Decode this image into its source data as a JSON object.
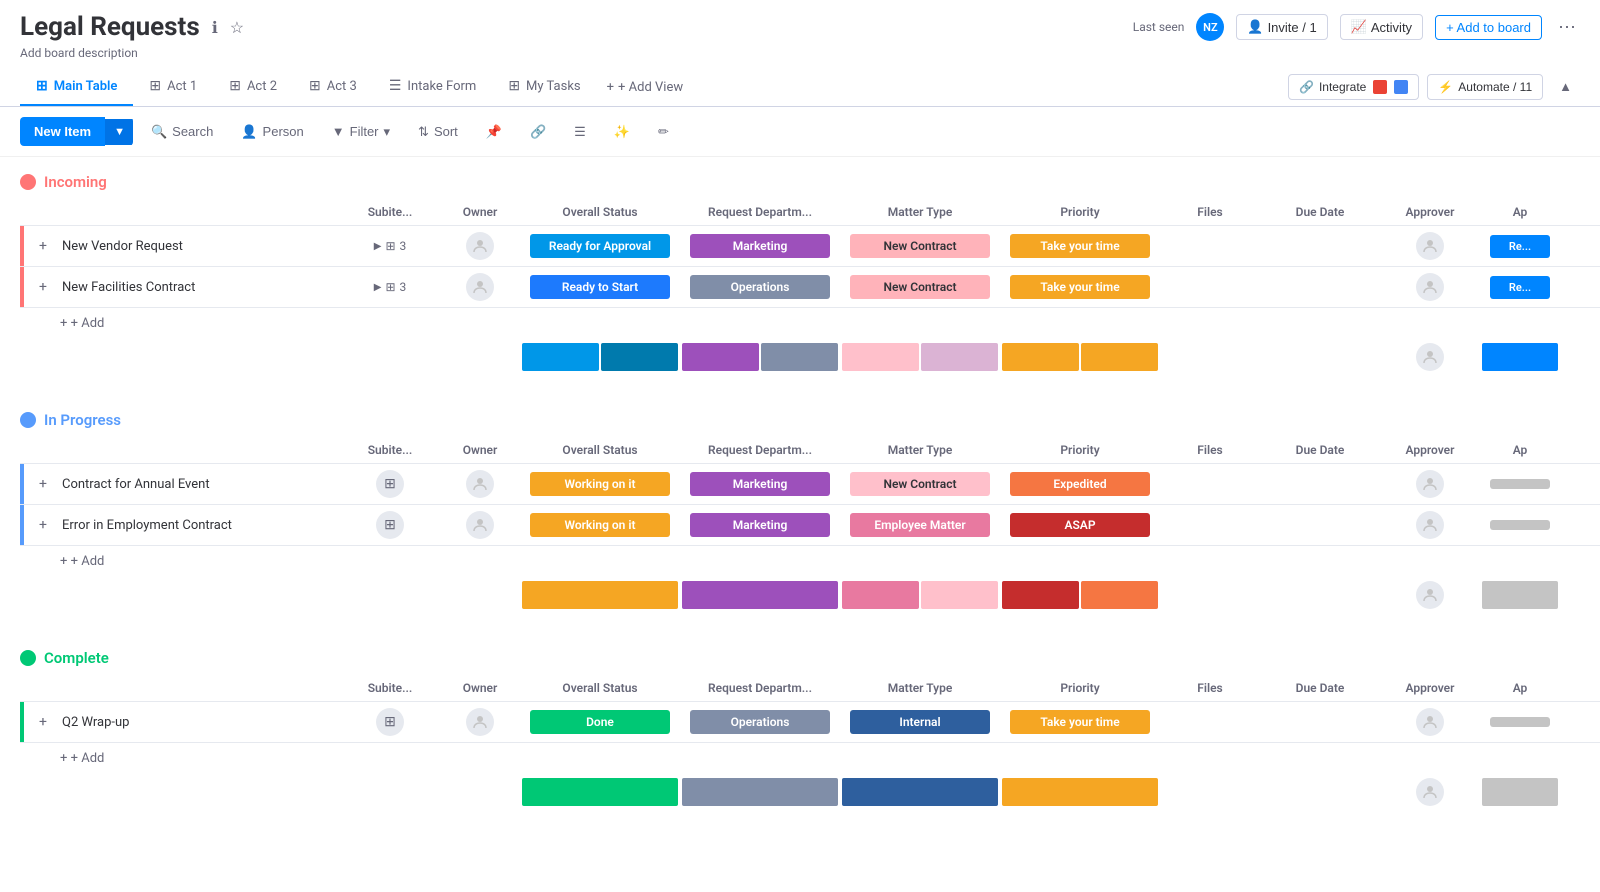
{
  "header": {
    "title": "Legal Requests",
    "board_desc": "Add board description",
    "last_seen_label": "Last seen",
    "invite_label": "Invite / 1",
    "activity_label": "Activity",
    "add_board_label": "+ Add to board"
  },
  "tabs": [
    {
      "label": "Main Table",
      "icon": "⊞",
      "active": true
    },
    {
      "label": "Act 1",
      "icon": "⊞",
      "active": false
    },
    {
      "label": "Act 2",
      "icon": "⊞",
      "active": false
    },
    {
      "label": "Act 3",
      "icon": "⊞",
      "active": false
    },
    {
      "label": "Intake Form",
      "icon": "☰",
      "active": false
    },
    {
      "label": "My Tasks",
      "icon": "⊞",
      "active": false
    }
  ],
  "tabs_right": {
    "integrate_label": "Integrate",
    "automate_label": "Automate / 11",
    "add_view_label": "+ Add View"
  },
  "toolbar": {
    "new_item_label": "New Item",
    "search_label": "Search",
    "person_label": "Person",
    "filter_label": "Filter",
    "sort_label": "Sort"
  },
  "columns": {
    "item_name": "",
    "subitem": "Subite...",
    "owner": "Owner",
    "overall_status": "Overall Status",
    "request_dept": "Request Departm...",
    "matter_type": "Matter Type",
    "priority": "Priority",
    "files": "Files",
    "due_date": "Due Date",
    "approver": "Approver",
    "ap": "Ap"
  },
  "groups": [
    {
      "id": "incoming",
      "name": "Incoming",
      "color_class": "incoming",
      "dot_class": "incoming",
      "rows": [
        {
          "name": "New Vendor Request",
          "subitem_count": "3",
          "owner": "",
          "status": "Ready for Approval",
          "status_color": "#0097e8",
          "dept": "Marketing",
          "dept_color": "#9d50bb",
          "matter": "New Contract",
          "matter_color": "#ffb3ba",
          "priority": "Take your time",
          "priority_color": "#f5a623",
          "files": "",
          "due_date": "",
          "approver": "",
          "ap": "Re...",
          "ap_color": "#0085ff",
          "indicator": "red"
        },
        {
          "name": "New Facilities Contract",
          "subitem_count": "3",
          "owner": "",
          "status": "Ready to Start",
          "status_color": "#1d7afd",
          "dept": "Operations",
          "dept_color": "#808ea8",
          "matter": "New Contract",
          "matter_color": "#ffb3ba",
          "priority": "Take your time",
          "priority_color": "#f5a623",
          "files": "",
          "due_date": "",
          "approver": "",
          "ap": "Re...",
          "ap_color": "#0085ff",
          "indicator": "red"
        }
      ],
      "summary": {
        "status_bars": [
          {
            "color": "#0097e8"
          },
          {
            "color": "#007aad"
          }
        ],
        "dept_bars": [
          {
            "color": "#9d50bb"
          },
          {
            "color": "#808ea8"
          }
        ],
        "matter_bars": [
          {
            "color": "#ffc0cb"
          },
          {
            "color": "#dbb3d4"
          }
        ],
        "priority_bars": [
          {
            "color": "#f5a623"
          },
          {
            "color": "#f5a623"
          }
        ],
        "ap_bars": [
          {
            "color": "#0085ff"
          }
        ]
      }
    },
    {
      "id": "inprogress",
      "name": "In Progress",
      "color_class": "inprogress",
      "dot_class": "inprogress",
      "rows": [
        {
          "name": "Contract for Annual Event",
          "subitem_count": "",
          "owner": "",
          "status": "Working on it",
          "status_color": "#f5a623",
          "dept": "Marketing",
          "dept_color": "#9d50bb",
          "matter": "New Contract",
          "matter_color": "#ffc0cb",
          "priority": "Expedited",
          "priority_color": "#f57642",
          "files": "",
          "due_date": "",
          "approver": "",
          "ap": "",
          "ap_color": "#c4c4c4",
          "indicator": "blue"
        },
        {
          "name": "Error in Employment Contract",
          "subitem_count": "",
          "owner": "",
          "status": "Working on it",
          "status_color": "#f5a623",
          "dept": "Marketing",
          "dept_color": "#9d50bb",
          "matter": "Employee Matter",
          "matter_color": "#e879a0",
          "priority": "ASAP",
          "priority_color": "#c52d2d",
          "files": "",
          "due_date": "",
          "approver": "",
          "ap": "",
          "ap_color": "#c4c4c4",
          "indicator": "blue"
        }
      ],
      "summary": {
        "status_bars": [
          {
            "color": "#f5a623"
          }
        ],
        "dept_bars": [
          {
            "color": "#9d50bb"
          }
        ],
        "matter_bars": [
          {
            "color": "#e879a0"
          },
          {
            "color": "#ffc0cb"
          }
        ],
        "priority_bars": [
          {
            "color": "#c52d2d"
          },
          {
            "color": "#f57642"
          }
        ],
        "ap_bars": [
          {
            "color": "#c4c4c4"
          }
        ]
      }
    },
    {
      "id": "complete",
      "name": "Complete",
      "color_class": "complete",
      "dot_class": "complete",
      "rows": [
        {
          "name": "Q2 Wrap-up",
          "subitem_count": "",
          "owner": "",
          "status": "Done",
          "status_color": "#00c875",
          "dept": "Operations",
          "dept_color": "#808ea8",
          "matter": "Internal",
          "matter_color": "#1d7afd",
          "priority": "Take your time",
          "priority_color": "#f5a623",
          "files": "",
          "due_date": "",
          "approver": "",
          "ap": "",
          "ap_color": "#c4c4c4",
          "indicator": "green"
        }
      ],
      "summary": {
        "status_bars": [
          {
            "color": "#00c875"
          }
        ],
        "dept_bars": [
          {
            "color": "#808ea8"
          }
        ],
        "matter_bars": [
          {
            "color": "#1d7afd"
          }
        ],
        "priority_bars": [
          {
            "color": "#f5a623"
          }
        ],
        "ap_bars": [
          {
            "color": "#c4c4c4"
          }
        ]
      }
    }
  ],
  "add_row_label": "+ Add",
  "avatar_initials": "NZ"
}
